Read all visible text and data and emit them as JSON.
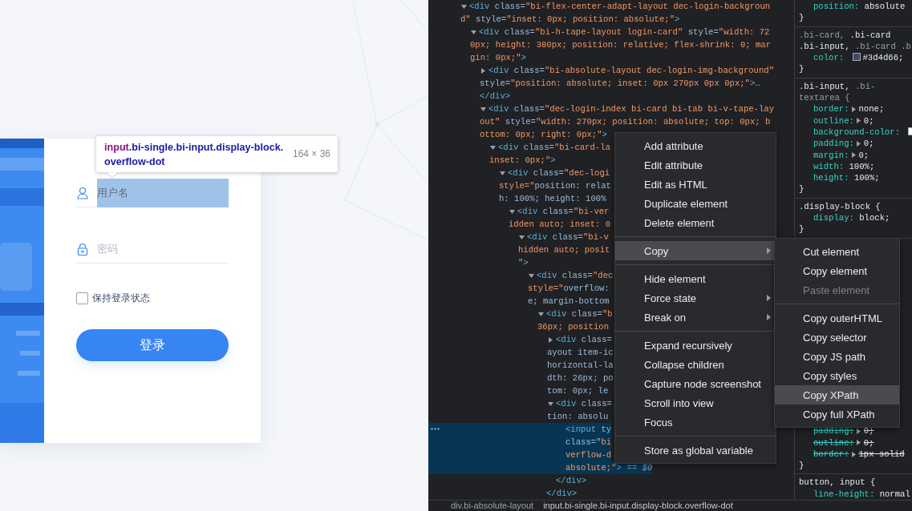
{
  "login_page": {
    "login_form": {
      "username": {
        "placeholder": "用户名",
        "inspected": true
      },
      "password": {
        "placeholder": "密码"
      },
      "remember": {
        "label": "保持登录状态",
        "checked": false
      },
      "submit": {
        "label": "登录"
      }
    },
    "inspect_tooltip": {
      "tag": "input",
      "classes": ".bi-single.bi-input.display-block.overflow-dot",
      "size": "164 × 36"
    }
  },
  "elements_tree": [
    {
      "lines": [
        "<div class=\"bi-flex-center-adapt-layout dec-login-backgroun",
        "d\" style=\"inset: 0px; position: absolute;\">"
      ],
      "expanded": true,
      "selected": false,
      "children": [
        {
          "lines": [
            "<div class=\"bi-h-tape-layout login-card\" style=\"width: 72",
            "0px; height: 380px; position: relative; flex-shrink: 0; mar",
            "gin: 0px;\">"
          ],
          "expanded": true,
          "selected": false,
          "children": [
            {
              "lines": [
                "<div class=\"bi-absolute-layout dec-login-img-background\"",
                "style=\"position: absolute; inset: 0px 270px 0px 0px;\">…",
                "</div>"
              ],
              "expanded": false,
              "selected": false
            },
            {
              "lines": [
                "<div class=\"dec-login-index bi-card bi-tab bi-v-tape-lay",
                "out\" style=\"width: 270px; position: absolute; top: 0px; b",
                "ottom: 0px; right: 0px;\">"
              ],
              "expanded": true,
              "selected": false,
              "children": [
                {
                  "lines": [
                    "<div class=\"bi-card-la",
                    "inset: 0px;\">"
                  ],
                  "expanded": true,
                  "selected": false,
                  "children": [
                    {
                      "lines": [
                        "<div class=\"dec-logi",
                        "style=\"position: relat",
                        "h: 100%; height: 100%"
                      ],
                      "expanded": true,
                      "selected": false,
                      "children": [
                        {
                          "lines": [
                            "<div class=\"bi-ver",
                            "idden auto; inset: 0"
                          ],
                          "expanded": true,
                          "selected": false,
                          "children": [
                            {
                              "lines": [
                                "<div class=\"bi-v",
                                "hidden auto; posit",
                                "\">"
                              ],
                              "expanded": true,
                              "selected": false,
                              "children": [
                                {
                                  "lines": [
                                    "<div class=\"dec",
                                    "style=\"overflow:",
                                    "e; margin-bottom"
                                  ],
                                  "expanded": true,
                                  "selected": false,
                                  "children": [
                                    {
                                      "lines": [
                                        "<div class=\"b",
                                        "36px; position"
                                      ],
                                      "expanded": true,
                                      "selected": false,
                                      "closing": "</div>",
                                      "children": [
                                        {
                                          "lines": [
                                            "<div class=",
                                            "ayout item-ic",
                                            "horizontal-la",
                                            "dth: 26px; po",
                                            "tom: 0px; le"
                                          ],
                                          "expanded": false,
                                          "selected": false
                                        },
                                        {
                                          "lines": [
                                            "<div class=",
                                            "tion: absolu"
                                          ],
                                          "expanded": true,
                                          "selected": false,
                                          "closing": "</div>",
                                          "children": [
                                            {
                                              "lines": [
                                                "<input ty",
                                                "class=\"bi",
                                                "verflow-d",
                                                "absolute;\">"
                                              ],
                                              "selected": true,
                                              "reference": "== $0"
                                            }
                                          ]
                                        }
                                      ]
                                    }
                                  ]
                                }
                              ]
                            }
                          ]
                        }
                      ]
                    }
                  ]
                }
              ]
            }
          ]
        }
      ]
    }
  ],
  "context_menu": {
    "groups": [
      [
        {
          "label": "Add attribute",
          "selected": false
        },
        {
          "label": "Edit attribute",
          "selected": false
        },
        {
          "label": "Edit as HTML",
          "selected": false
        },
        {
          "label": "Duplicate element",
          "selected": false
        },
        {
          "label": "Delete element",
          "selected": false
        }
      ],
      [
        {
          "label": "Copy",
          "selected": true,
          "submenu": true
        }
      ],
      [
        {
          "label": "Hide element",
          "selected": false
        },
        {
          "label": "Force state",
          "selected": false,
          "submenu": true
        },
        {
          "label": "Break on",
          "selected": false,
          "submenu": true
        }
      ],
      [
        {
          "label": "Expand recursively",
          "selected": false
        },
        {
          "label": "Collapse children",
          "selected": false
        },
        {
          "label": "Capture node screenshot",
          "selected": false
        },
        {
          "label": "Scroll into view",
          "selected": false
        },
        {
          "label": "Focus",
          "selected": false
        }
      ],
      [
        {
          "label": "Store as global variable",
          "selected": false
        }
      ]
    ]
  },
  "copy_submenu": {
    "groups": [
      [
        {
          "label": "Cut element",
          "selected": false,
          "disabled": false
        },
        {
          "label": "Copy element",
          "selected": false,
          "disabled": false
        },
        {
          "label": "Paste element",
          "selected": false,
          "disabled": true
        }
      ],
      [
        {
          "label": "Copy outerHTML",
          "selected": false,
          "disabled": false
        },
        {
          "label": "Copy selector",
          "selected": false,
          "disabled": false
        },
        {
          "label": "Copy JS path",
          "selected": false,
          "disabled": false
        },
        {
          "label": "Copy styles",
          "selected": false,
          "disabled": false
        },
        {
          "label": "Copy XPath",
          "selected": true,
          "disabled": false
        },
        {
          "label": "Copy full XPath",
          "selected": false,
          "disabled": false
        }
      ]
    ]
  },
  "styles": {
    "rules_top": [
      {
        "declarations": [
          {
            "name": "position:",
            "value": "absolute"
          }
        ],
        "closing": "}"
      },
      {
        "selector_lines": [
          [
            {
              "text": ".bi-card, ",
              "matched": false
            },
            {
              "text": ".bi-card",
              "matched": true
            }
          ],
          [
            {
              "text": ".bi-input,",
              "matched": true
            },
            {
              "text": " .bi-card .b",
              "matched": false
            }
          ]
        ],
        "declarations": [
          {
            "name": "color:",
            "color": "#3d4d66",
            "value": "#3d4d66;"
          }
        ],
        "closing": "}"
      },
      {
        "selector_lines": [
          [
            {
              "text": ".bi-input,",
              "matched": true
            },
            {
              "text": " .bi-",
              "matched": false
            }
          ],
          [
            {
              "text": "textarea {",
              "matched": false
            }
          ]
        ],
        "declarations": [
          {
            "name": "border:",
            "expandable": true,
            "value": "none;"
          },
          {
            "name": "outline:",
            "expandable": true,
            "value": "0;"
          },
          {
            "name": "background-color:",
            "color": "#ffffff"
          },
          {
            "name": "padding:",
            "expandable": true,
            "value": "0;"
          },
          {
            "name": "margin:",
            "expandable": true,
            "value": "0;"
          },
          {
            "name": "width:",
            "value": "100%;"
          },
          {
            "name": "height:",
            "value": "100%;"
          }
        ],
        "closing": "}"
      },
      {
        "selector_lines": [
          [
            {
              "text": ".display-block {",
              "matched": true
            }
          ]
        ],
        "declarations": [
          {
            "name": "display:",
            "value": "block;"
          }
        ],
        "closing": "}"
      }
    ],
    "rules_bottom": [
      {
        "declarations": [
          {
            "name": "padding:",
            "expandable": true,
            "value": "0;",
            "struck": true
          },
          {
            "name": "outline:",
            "expandable": true,
            "value": "0;",
            "struck": true
          },
          {
            "name": "border:",
            "expandable": true,
            "value": "1px solid",
            "struck": true
          }
        ],
        "closing": "}"
      },
      {
        "selector_lines": [
          [
            {
              "text": "button, input {",
              "matched": true
            }
          ]
        ],
        "declarations": [
          {
            "name": "line-height:",
            "value": "normal"
          }
        ]
      }
    ]
  },
  "breadcrumbs": [
    {
      "label": "div.bi-absolute-layout",
      "selected": false
    },
    {
      "label": "input.bi-single.bi-input.display-block.overflow-dot",
      "selected": true
    }
  ]
}
